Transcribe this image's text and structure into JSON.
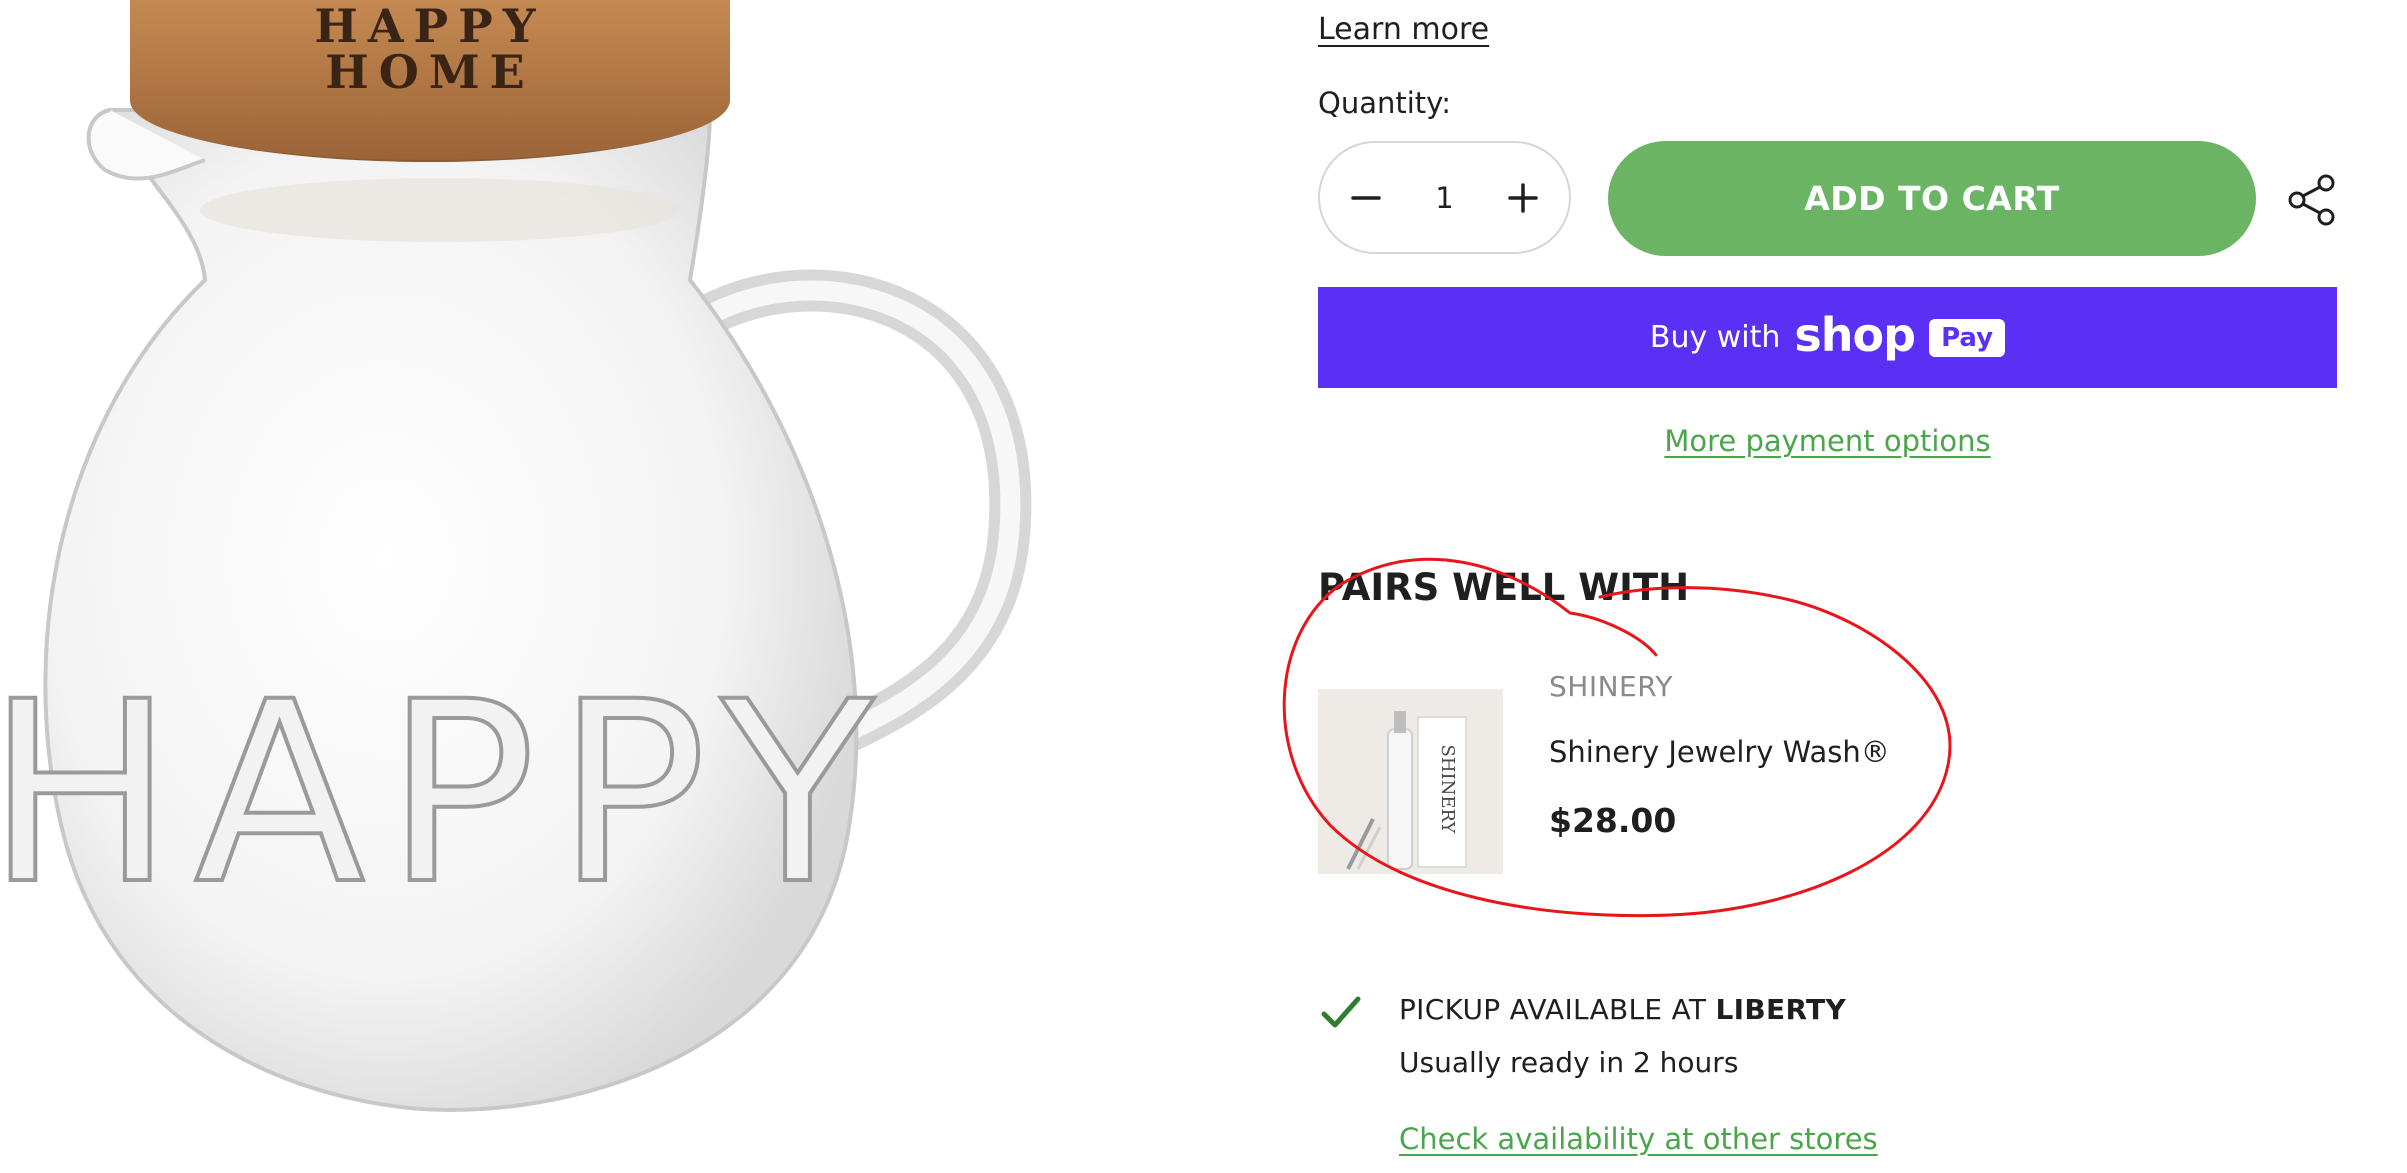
{
  "product_image": {
    "lid_text_line1": "HAPPY",
    "lid_text_line2": "HOME",
    "embossed_text": "HAPPY"
  },
  "purchase": {
    "learn_more": "Learn more",
    "quantity_label": "Quantity:",
    "quantity_value": "1",
    "decrease_icon": "minus-icon",
    "increase_icon": "plus-icon",
    "add_to_cart": "ADD TO CART",
    "share_icon": "share-icon",
    "shop_pay": {
      "buy_with": "Buy with",
      "shop": "shop",
      "pay": "Pay"
    },
    "more_payment_options": "More payment options"
  },
  "pairs_well_with": {
    "title": "PAIRS WELL WITH",
    "items": [
      {
        "vendor": "SHINERY",
        "name": "Shinery Jewelry Wash®",
        "price": "$28.00",
        "thumb_label": "SHINERY"
      }
    ]
  },
  "pickup": {
    "prefix": "PICKUP AVAILABLE AT",
    "store": "LIBERTY",
    "ready": "Usually ready in 2 hours",
    "check_other_stores": "Check availability at other stores"
  },
  "colors": {
    "accent_green": "#6ab463",
    "link_green": "#4aa64a",
    "shop_pay_purple": "#5a31f4",
    "annotation_red": "#e8161b"
  }
}
